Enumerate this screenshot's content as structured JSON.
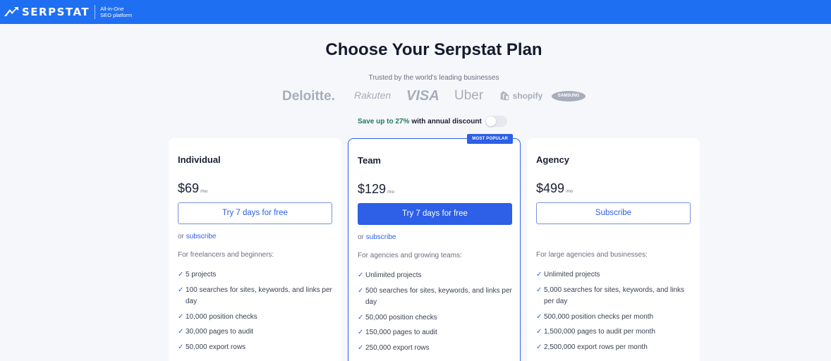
{
  "header": {
    "logo_text": "SERPSTAT",
    "tagline_line1": "All-in-One",
    "tagline_line2": "SEO platform",
    "brand_color": "#1f6ff2"
  },
  "title": "Choose Your Serpstat Plan",
  "trusted_text": "Trusted by the world's leading businesses",
  "brands": [
    "Deloitte.",
    "Rakuten",
    "VISA",
    "Uber",
    "shopify",
    "SAMSUNG"
  ],
  "discount": {
    "accent": "Save up to 27%",
    "rest": "with annual discount",
    "annual_enabled": false
  },
  "plans": [
    {
      "name": "Individual",
      "price": "$69",
      "per": "/mo",
      "cta": "Try 7 days for free",
      "alt_prefix": "or",
      "alt_link": "subscribe",
      "description": "For freelancers and beginners:",
      "features": [
        "5 projects",
        "100 searches for sites, keywords, and links per day",
        "10,000 position checks",
        "30,000 pages to audit",
        "50,000 export rows"
      ]
    },
    {
      "name": "Team",
      "badge": "MOST POPULAR",
      "price": "$129",
      "per": "/mo",
      "cta": "Try 7 days for free",
      "alt_prefix": "or",
      "alt_link": "subscribe",
      "description": "For agencies and growing teams:",
      "features": [
        "Unlimited projects",
        "500 searches for sites, keywords, and links per day",
        "50,000 position checks",
        "150,000 pages to audit",
        "250,000 export rows"
      ]
    },
    {
      "name": "Agency",
      "price": "$499",
      "per": "/mo",
      "cta": "Subscribe",
      "description": "For large agencies and businesses:",
      "features": [
        "Unlimited projects",
        "5,000 searches for sites, keywords, and links per day",
        "500,000 position checks per month",
        "1,500,000 pages to audit per month",
        "2,500,000 export rows per month"
      ]
    }
  ],
  "check_glyph": "✓",
  "colors": {
    "accent": "#2d5fe7",
    "discount_accent": "#1d7a5a"
  }
}
